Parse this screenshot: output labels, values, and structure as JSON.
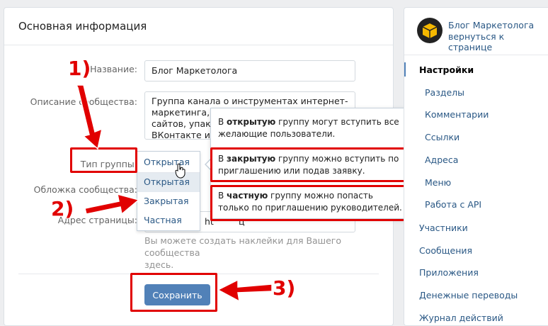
{
  "main": {
    "title": "Основная информация",
    "name_label": "Название:",
    "name_value": "Блог Маркетолога",
    "desc_label": "Описание сообщества:",
    "desc_lines": [
      "Группа канала о инструментах интернет-",
      "маркетинга, з",
      "сайтов, упако",
      "ВКонтакте и с"
    ],
    "type_label": "Тип группы:",
    "cover_label": "Обложка сообщества:",
    "address_label": "Адрес страницы:",
    "address_value": "ht",
    "address_suffix": "ц",
    "hint": "Вы можете создать наклейки для Вашего сообщества здесь.",
    "hint_line1": "Вы можете создать наклейки для Вашего сообщества",
    "hint_line2": "здесь.",
    "save_label": "Сохранить"
  },
  "dropdown": {
    "selected": "Открытая",
    "options": [
      "Открытая",
      "Закрытая",
      "Частная"
    ]
  },
  "tooltip": {
    "open_pre": "В ",
    "open_bold": "открытую",
    "open_post": " группу могут вступить все желающие пользователи.",
    "closed_pre": "В ",
    "closed_bold": "закрытую",
    "closed_post": " группу можно вступить по приглашению или подав заявку.",
    "private_pre": "В ",
    "private_bold": "частную",
    "private_post": " группу можно попасть только по приглашению руководителей."
  },
  "annotations": {
    "n1": "1)",
    "n2": "2)",
    "n3": "3)"
  },
  "side": {
    "title": "Блог Маркетолога",
    "subtitle": "вернуться к странице",
    "items": [
      "Настройки",
      "Разделы",
      "Комментарии",
      "Ссылки",
      "Адреса",
      "Меню",
      "Работа с API",
      "Участники",
      "Сообщения",
      "Приложения",
      "Денежные переводы",
      "Журнал действий"
    ]
  },
  "colors": {
    "accent": "#5181b8",
    "link": "#2a5885",
    "annotation": "#e10000"
  }
}
